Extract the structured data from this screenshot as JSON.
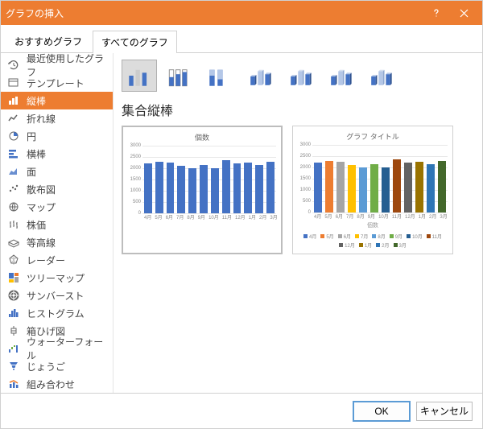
{
  "dialog": {
    "title": "グラフの挿入"
  },
  "tabs": {
    "recommended": "おすすめグラフ",
    "all": "すべてのグラフ",
    "active": "all"
  },
  "categories": [
    {
      "id": "recent",
      "label": "最近使用したグラフ"
    },
    {
      "id": "template",
      "label": "テンプレート"
    },
    {
      "id": "column",
      "label": "縦棒"
    },
    {
      "id": "line",
      "label": "折れ線"
    },
    {
      "id": "pie",
      "label": "円"
    },
    {
      "id": "bar",
      "label": "横棒"
    },
    {
      "id": "area",
      "label": "面"
    },
    {
      "id": "scatter",
      "label": "散布図"
    },
    {
      "id": "map",
      "label": "マップ"
    },
    {
      "id": "stock",
      "label": "株価"
    },
    {
      "id": "surface",
      "label": "等高線"
    },
    {
      "id": "radar",
      "label": "レーダー"
    },
    {
      "id": "treemap",
      "label": "ツリーマップ"
    },
    {
      "id": "sunburst",
      "label": "サンバースト"
    },
    {
      "id": "histogram",
      "label": "ヒストグラム"
    },
    {
      "id": "boxplot",
      "label": "箱ひげ図"
    },
    {
      "id": "waterfall",
      "label": "ウォーターフォール"
    },
    {
      "id": "funnel",
      "label": "じょうご"
    },
    {
      "id": "combo",
      "label": "組み合わせ"
    }
  ],
  "selectedCategory": "column",
  "subtitle": "集合縦棒",
  "footer": {
    "ok": "OK",
    "cancel": "キャンセル"
  },
  "chart_data": [
    {
      "type": "bar",
      "title": "個数",
      "categories": [
        "4月",
        "5月",
        "6月",
        "7月",
        "8月",
        "9月",
        "10月",
        "11月",
        "12月",
        "1月",
        "2月",
        "3月"
      ],
      "values": [
        2200,
        2300,
        2250,
        2100,
        2000,
        2150,
        2000,
        2350,
        2200,
        2250,
        2150,
        2300
      ],
      "ylim": [
        0,
        3000
      ],
      "yticks": [
        0,
        500,
        1000,
        1500,
        2000,
        2500,
        3000
      ],
      "color": "#4472c4"
    },
    {
      "type": "bar",
      "title": "グラフ タイトル",
      "xlabel": "個数",
      "categories": [
        "4月",
        "5月",
        "6月",
        "7月",
        "8月",
        "9月",
        "10月",
        "11月",
        "12月",
        "1月",
        "2月",
        "3月"
      ],
      "values": [
        2200,
        2300,
        2250,
        2100,
        2000,
        2150,
        2000,
        2350,
        2200,
        2250,
        2150,
        2300
      ],
      "ylim": [
        0,
        3000
      ],
      "yticks": [
        0,
        500,
        1000,
        1500,
        2000,
        2500,
        3000
      ],
      "colors": [
        "#4472c4",
        "#ed7d31",
        "#a5a5a5",
        "#ffc000",
        "#5b9bd5",
        "#70ad47",
        "#255e91",
        "#9e480e",
        "#636363",
        "#997300",
        "#2e75b6",
        "#43682b"
      ]
    }
  ]
}
